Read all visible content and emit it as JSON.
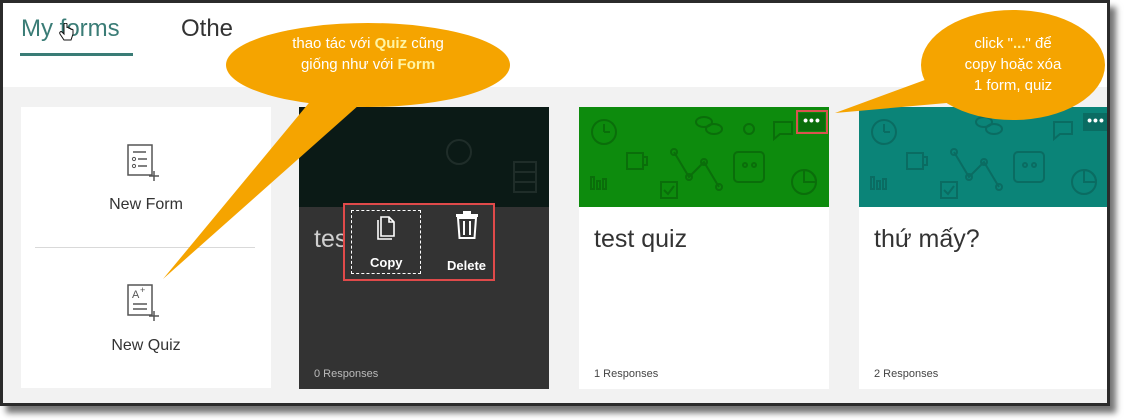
{
  "tabs": {
    "my_forms": "My forms",
    "others": "Othe"
  },
  "new_panel": {
    "new_form_label": "New Form",
    "new_quiz_label": "New Quiz"
  },
  "cards": [
    {
      "title": "test form",
      "responses": "0 Responses"
    },
    {
      "title": "test quiz",
      "responses": "1 Responses",
      "more": "•••"
    },
    {
      "title": "thứ mấy?",
      "responses": "2 Responses",
      "more": "•••"
    }
  ],
  "actions": {
    "copy_label": "Copy",
    "delete_label": "Delete"
  },
  "callouts": {
    "left": {
      "line1_pre": "thao tác với ",
      "line1_bold": "Quiz",
      "line1_post": " cũng",
      "line2_pre": "giống như với ",
      "line2_bold": "Form"
    },
    "right": {
      "line1_pre": "click \"",
      "line1_bold": "...",
      "line1_post": "\" để",
      "line2": "copy hoặc xóa",
      "line3": "1 form, quiz"
    }
  },
  "colors": {
    "accent": "#3a7c76",
    "quiz_green": "#0d8b0d",
    "teal": "#0b8478",
    "callout": "#f5a400",
    "highlight": "#e04a4a"
  },
  "icons": [
    "new-form-icon",
    "new-quiz-icon",
    "copy-icon",
    "delete-icon",
    "more-icon",
    "hand-cursor-icon"
  ]
}
